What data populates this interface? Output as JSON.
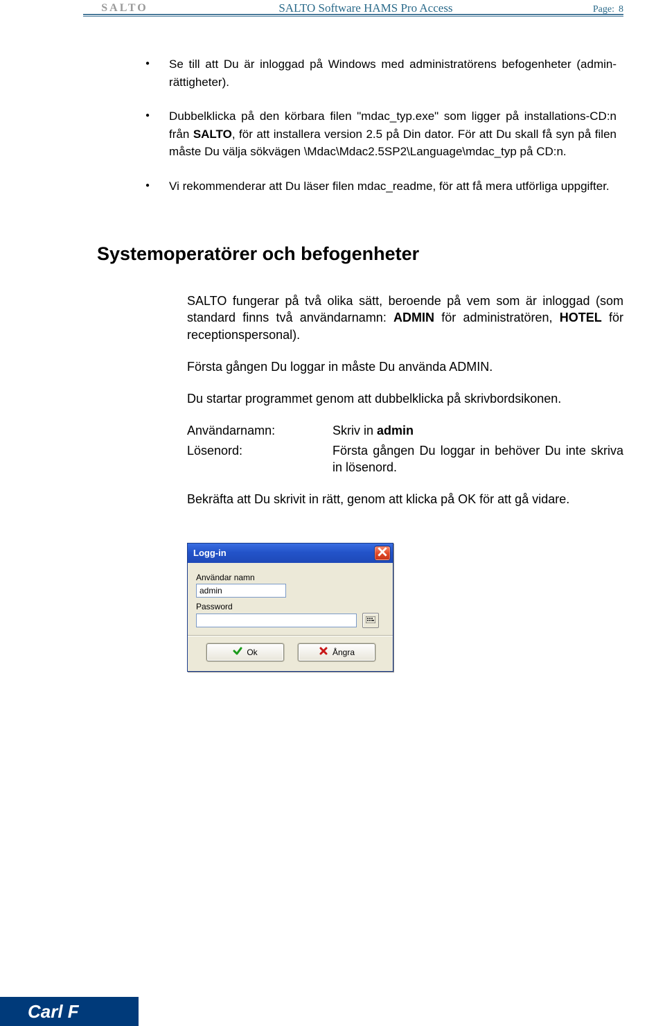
{
  "header": {
    "logo": "SALTO",
    "title": "SALTO Software HAMS Pro Access",
    "page_label": "Page:",
    "page_number": "8"
  },
  "bullets": [
    {
      "text": "Se till att Du är inloggad på Windows med administratörens befogenheter (admin-rättigheter)."
    },
    {
      "prefix": "Dubbelklicka på den körbara filen \"mdac_typ.exe\" som ligger på installations-CD:n från ",
      "bold1": "SALTO",
      "suffix": ", för att installera version 2.5 på Din dator. För att Du skall få syn på filen måste Du välja sökvägen \\Mdac\\Mdac2.5SP2\\Language\\mdac_typ på CD:n."
    },
    {
      "text": "Vi rekommenderar att Du läser filen mdac_readme, för att få mera utförliga uppgifter."
    }
  ],
  "section_title": "Systemoperatörer och befogenheter",
  "para1": {
    "pre": "SALTO fungerar på två olika sätt, beroende på vem som är inloggad (som standard finns två användarnamn: ",
    "b1": "ADMIN",
    "mid": " för administratören, ",
    "b2": "HOTEL",
    "post": " för receptionspersonal)."
  },
  "para2": "Första gången Du loggar in måste Du använda ADMIN.",
  "para3": "Du startar programmet genom att dubbelklicka på skrivbordsikonen.",
  "rows": {
    "user_label": "Användarnamn:",
    "user_value_pre": "Skriv in ",
    "user_value_bold": "admin",
    "pass_label": "Lösenord:",
    "pass_value": "Första gången Du loggar in behöver Du inte skriva in lösenord."
  },
  "para4": "Bekräfta att Du skrivit in rätt, genom att klicka på OK för att gå vidare.",
  "dialog": {
    "title": "Logg-in",
    "user_label": "Användar namn",
    "user_value": "admin",
    "pass_label": "Password",
    "pass_value": "",
    "ok": "Ok",
    "cancel": "Ångra"
  },
  "footer": {
    "brand": "Carl F"
  }
}
